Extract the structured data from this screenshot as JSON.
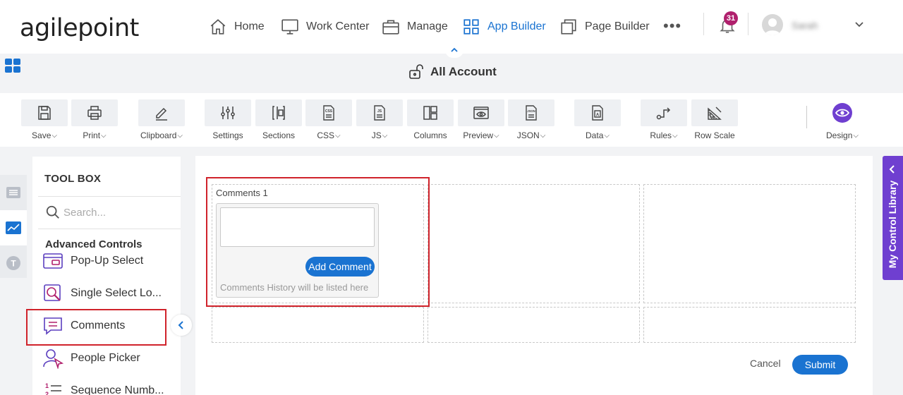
{
  "brand": {
    "logo_text": "agilepoint"
  },
  "nav": {
    "items": [
      {
        "label": "Home",
        "icon": "home-icon"
      },
      {
        "label": "Work Center",
        "icon": "monitor-icon"
      },
      {
        "label": "Manage",
        "icon": "briefcase-icon"
      },
      {
        "label": "App Builder",
        "icon": "grid-icon",
        "active": true
      },
      {
        "label": "Page Builder",
        "icon": "copy-icon"
      }
    ],
    "more_label": "•••",
    "notifications_count": "31",
    "user_name": "Sarah",
    "accent_color": "#1a73d1",
    "badge_color": "#b0206d"
  },
  "app": {
    "title": "All Account",
    "icon": "unlock-icon"
  },
  "toolbar": {
    "items": [
      {
        "label": "Save",
        "icon": "save-icon",
        "dropdown": true
      },
      {
        "label": "Print",
        "icon": "printer-icon",
        "dropdown": true
      },
      {
        "label": "Clipboard",
        "icon": "pencil-icon",
        "dropdown": true
      },
      {
        "label": "Settings",
        "icon": "sliders-icon",
        "dropdown": false
      },
      {
        "label": "Sections",
        "icon": "sections-icon",
        "dropdown": false
      },
      {
        "label": "CSS",
        "icon": "css-file-icon",
        "dropdown": true
      },
      {
        "label": "JS",
        "icon": "js-file-icon",
        "dropdown": true
      },
      {
        "label": "Columns",
        "icon": "columns-icon",
        "dropdown": false
      },
      {
        "label": "Preview",
        "icon": "eye-icon",
        "dropdown": true
      },
      {
        "label": "JSON",
        "icon": "json-file-icon",
        "dropdown": true
      },
      {
        "label": "Data",
        "icon": "data-file-icon",
        "dropdown": true
      },
      {
        "label": "Rules",
        "icon": "rules-icon",
        "dropdown": true
      },
      {
        "label": "Row Scale",
        "icon": "ruler-icon",
        "dropdown": false
      },
      {
        "label": "Design",
        "icon": "design-eye-icon",
        "dropdown": true
      }
    ],
    "dropdown_glyph": "⌵"
  },
  "toolbox": {
    "title": "TOOL BOX",
    "search_placeholder": "Search...",
    "section_title": "Advanced Controls",
    "controls": [
      {
        "label": "Pop-Up Select",
        "icon": "popup-select-icon"
      },
      {
        "label": "Single Select Lo...",
        "icon": "lookup-search-icon"
      },
      {
        "label": "Comments",
        "icon": "comment-icon",
        "selected": true
      },
      {
        "label": "People Picker",
        "icon": "people-picker-icon"
      },
      {
        "label": "Sequence Numb...",
        "icon": "numbered-list-icon"
      }
    ],
    "rail_letter": "T"
  },
  "form": {
    "comments_label": "Comments 1",
    "add_comment_label": "Add Comment",
    "history_text": "Comments History will be listed here",
    "cancel_label": "Cancel",
    "submit_label": "Submit",
    "highlight_color": "#d0232b"
  },
  "library": {
    "label": "My Control Library",
    "color": "#6f3fd0"
  }
}
